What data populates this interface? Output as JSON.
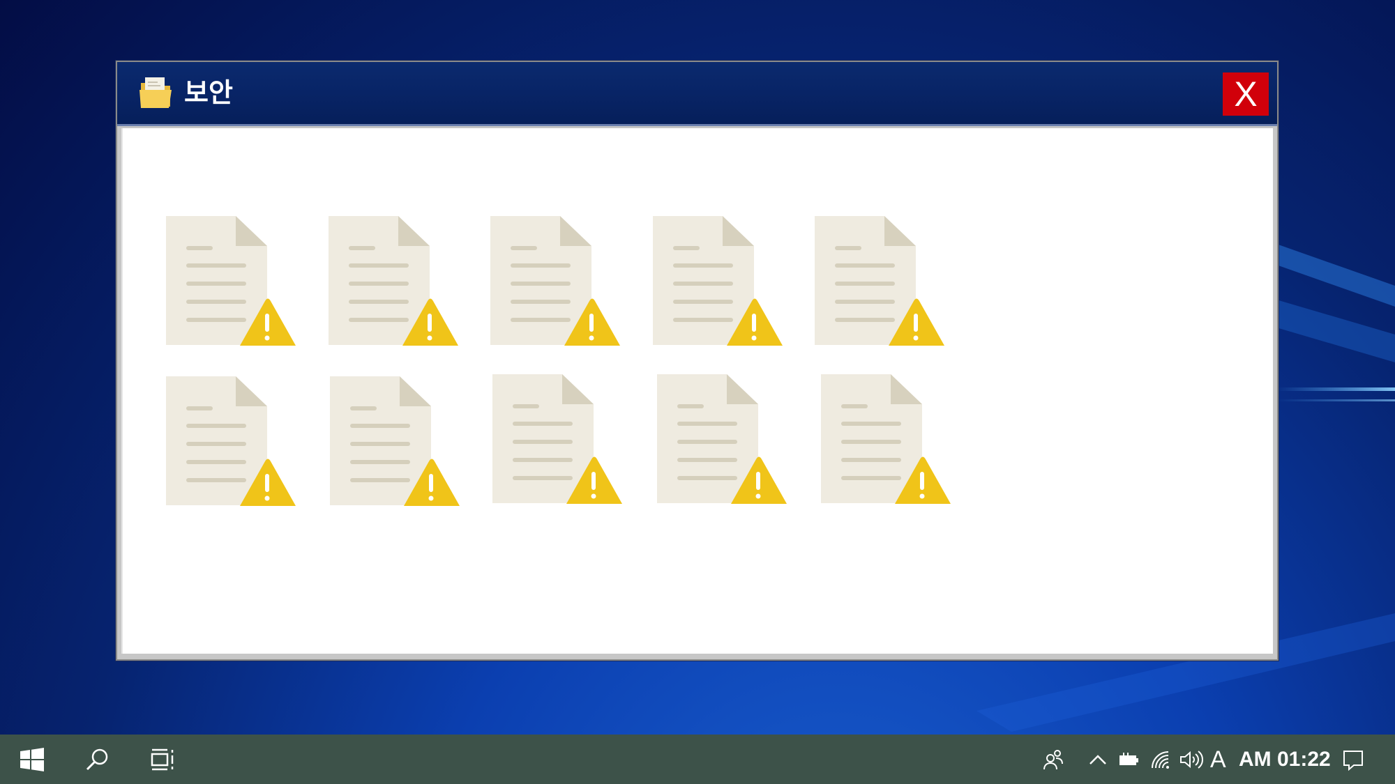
{
  "window": {
    "title": "보안",
    "close_label": "X",
    "icon": "folder-icon"
  },
  "files": {
    "icon": "document-warning-icon",
    "count": 10,
    "colors": {
      "page": "#efebe0",
      "fold": "#d7d1be",
      "lines": "#d5cfbc",
      "warning": "#f0c419",
      "warning_mark": "#ffffff"
    }
  },
  "taskbar": {
    "start_icon": "windows-logo-icon",
    "search_icon": "search-icon",
    "task_view_icon": "task-view-icon",
    "tray": {
      "people_icon": "people-icon",
      "chevron_icon": "chevron-up-icon",
      "battery_icon": "battery-icon",
      "wifi_icon": "wifi-icon",
      "volume_icon": "volume-icon",
      "ime_label": "A",
      "clock_text": "AM 01:22",
      "notification_icon": "notification-icon"
    }
  },
  "colors": {
    "titlebar": "#082466",
    "close_button": "#d1000a",
    "taskbar": "#3d5249"
  }
}
